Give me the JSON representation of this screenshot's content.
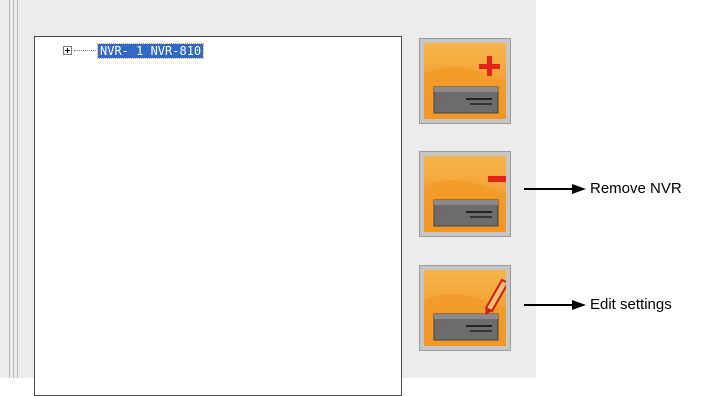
{
  "tree": {
    "nodes": [
      {
        "label": "NVR- 1 NVR-810",
        "expanded": false,
        "selected": true
      }
    ]
  },
  "buttons": [
    {
      "action": "add",
      "icon": "add-nvr-icon",
      "badge_color": "#e8201a"
    },
    {
      "action": "remove",
      "icon": "remove-nvr-icon",
      "badge_color": "#e8201a"
    },
    {
      "action": "edit",
      "icon": "edit-nvr-icon",
      "badge_color": "#e87020"
    }
  ],
  "callouts": {
    "remove": "Remove NVR",
    "edit": "Edit settings"
  },
  "colors": {
    "selection": "#3169c6",
    "icon_orange": "#f5a433",
    "icon_red": "#e8201a"
  }
}
